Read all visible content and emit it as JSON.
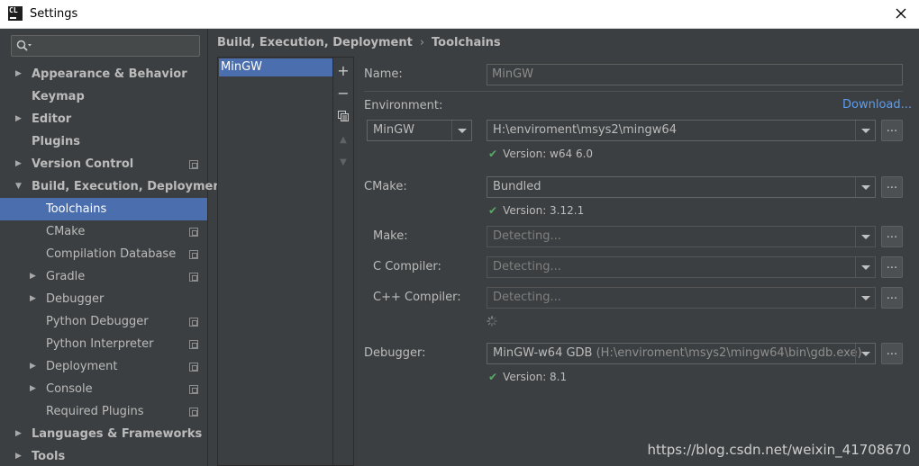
{
  "window": {
    "title": "Settings",
    "app_icon_text": "CL"
  },
  "sidebar": {
    "search_placeholder": "",
    "items": [
      {
        "label": "Appearance & Behavior",
        "bold": true,
        "arrow": "▶",
        "level": 0
      },
      {
        "label": "Keymap",
        "bold": true,
        "level": 0
      },
      {
        "label": "Editor",
        "bold": true,
        "arrow": "▶",
        "level": 0
      },
      {
        "label": "Plugins",
        "bold": true,
        "level": 0
      },
      {
        "label": "Version Control",
        "bold": true,
        "arrow": "▶",
        "level": 0,
        "project": true
      },
      {
        "label": "Build, Execution, Deployment",
        "bold": true,
        "arrow": "▼",
        "level": 0
      },
      {
        "label": "Toolchains",
        "level": 1,
        "selected": true
      },
      {
        "label": "CMake",
        "level": 1,
        "project": true
      },
      {
        "label": "Compilation Database",
        "level": 1,
        "project": true
      },
      {
        "label": "Gradle",
        "level": 1,
        "arrow": "▶",
        "project": true
      },
      {
        "label": "Debugger",
        "level": 1,
        "arrow": "▶"
      },
      {
        "label": "Python Debugger",
        "level": 1,
        "project": true
      },
      {
        "label": "Python Interpreter",
        "level": 1,
        "project": true
      },
      {
        "label": "Deployment",
        "level": 1,
        "arrow": "▶",
        "project": true
      },
      {
        "label": "Console",
        "level": 1,
        "arrow": "▶",
        "project": true
      },
      {
        "label": "Required Plugins",
        "level": 1,
        "project": true
      },
      {
        "label": "Languages & Frameworks",
        "bold": true,
        "arrow": "▶",
        "level": 0
      },
      {
        "label": "Tools",
        "bold": true,
        "arrow": "▶",
        "level": 0
      }
    ]
  },
  "breadcrumb": {
    "parent": "Build, Execution, Deployment",
    "separator": "›",
    "current": "Toolchains"
  },
  "toolchains": {
    "items": [
      "MinGW"
    ],
    "toolbar": {
      "add": "+",
      "remove": "−",
      "copy": "copy",
      "up": "▲",
      "down": "▼"
    }
  },
  "form": {
    "name_label": "Name:",
    "name_value": "MinGW",
    "environment_label": "Environment:",
    "download_link": "Download...",
    "environment_type": "MinGW",
    "environment_path": "H:\\enviroment\\msys2\\mingw64",
    "environment_version": "Version: w64 6.0",
    "cmake_label": "CMake:",
    "cmake_value": "Bundled",
    "cmake_version": "Version: 3.12.1",
    "make_label": "Make:",
    "make_value": "Detecting...",
    "c_label": "C Compiler:",
    "c_value": "Detecting...",
    "cpp_label": "C++ Compiler:",
    "cpp_value": "Detecting...",
    "debugger_label": "Debugger:",
    "debugger_name": "MinGW-w64 GDB",
    "debugger_path": "(H:\\enviroment\\msys2\\mingw64\\bin\\gdb.exe)",
    "debugger_version": "Version: 8.1",
    "browse_label": "...",
    "check_mark": "✔"
  },
  "watermark": "https://blog.csdn.net/weixin_41708670",
  "colors": {
    "selection": "#4b6eaf",
    "background": "#3c3f41",
    "link": "#589df6",
    "ok": "#59a869"
  }
}
